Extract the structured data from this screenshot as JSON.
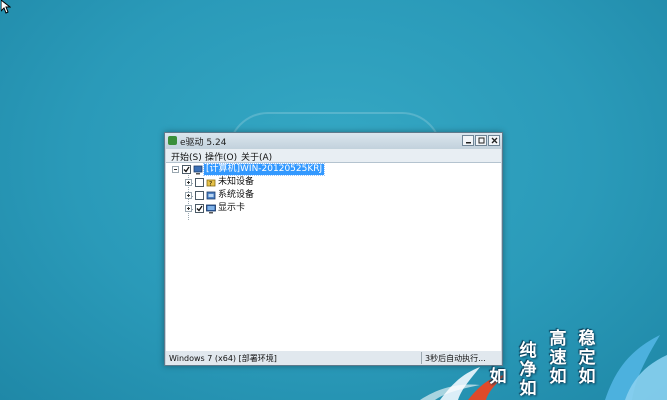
{
  "window": {
    "title": "e驱动 5.24",
    "controls": {
      "minimize": "minimize",
      "maximize": "maximize",
      "close": "close"
    }
  },
  "menu": [
    "开始(S)",
    "操作(O)",
    "关于(A)"
  ],
  "tree": {
    "root": {
      "label": "[计算机]WIN-20120525KRJ",
      "checked": true,
      "expanded": true,
      "selected": true,
      "icon": "computer-icon"
    },
    "children": [
      {
        "label": "未知设备",
        "checked": false,
        "icon": "unknown-device-icon"
      },
      {
        "label": "系统设备",
        "checked": false,
        "icon": "system-device-icon"
      },
      {
        "label": "显示卡",
        "checked": true,
        "icon": "display-card-icon"
      }
    ]
  },
  "status": {
    "os": "Windows 7 (x64) [部署环境]",
    "countdown": "3秒后自动执行..."
  },
  "slogan": {
    "columns": [
      "稳定如",
      "高速如",
      "纯净如",
      "如"
    ]
  },
  "colors": {
    "desktop": "#2a9ab9",
    "selection": "#3399ff",
    "accent": "#43b043"
  }
}
